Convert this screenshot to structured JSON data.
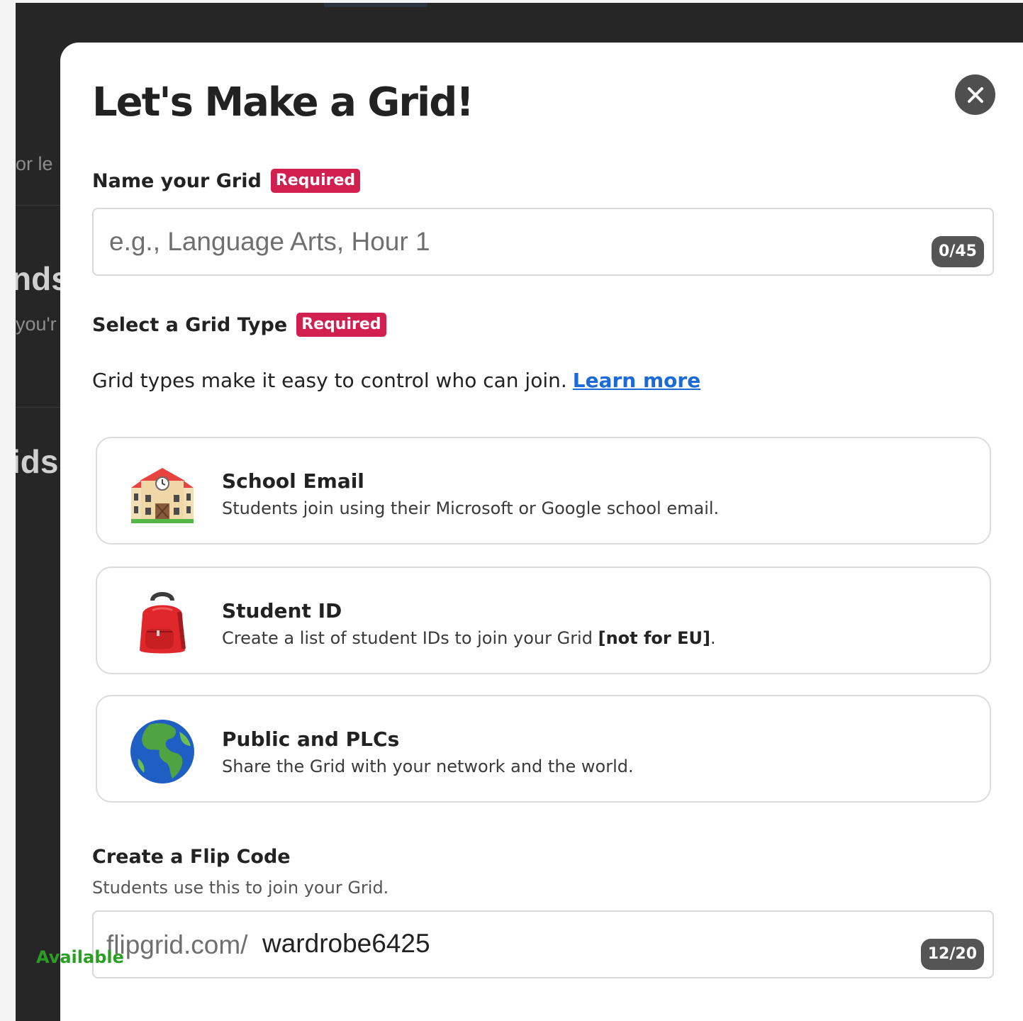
{
  "background": {
    "fragments": [
      "or le",
      "nds",
      "you'r",
      "ids"
    ]
  },
  "modal": {
    "title": "Let's Make a Grid!",
    "close_icon": "close-icon"
  },
  "name_field": {
    "label": "Name your Grid",
    "badge": "Required",
    "placeholder": "e.g., Language Arts, Hour 1",
    "value": "",
    "counter": "0/45"
  },
  "grid_type": {
    "label": "Select a Grid Type",
    "badge": "Required",
    "helper": "Grid types make it easy to control who can join.",
    "learn_more": "Learn more",
    "options": [
      {
        "icon": "school-building-icon",
        "title": "School Email",
        "description": "Students join using their Microsoft or Google school email."
      },
      {
        "icon": "backpack-icon",
        "title": "Student ID",
        "description": "Create a list of student IDs to join your Grid",
        "description_bold": "[not for EU]",
        "description_end": "."
      },
      {
        "icon": "globe-icon",
        "title": "Public and PLCs",
        "description": "Share the Grid with your network and the world."
      }
    ]
  },
  "flip_code": {
    "label": "Create a Flip Code",
    "helper": "Students use this to join your Grid.",
    "prefix": "flipgrid.com/",
    "value": "wardrobe6425",
    "counter": "12/20",
    "status": "Available"
  },
  "colors": {
    "required_badge": "#d1204f",
    "link": "#1c6ad6",
    "available": "#2a9d23",
    "backdrop": "#262626"
  }
}
